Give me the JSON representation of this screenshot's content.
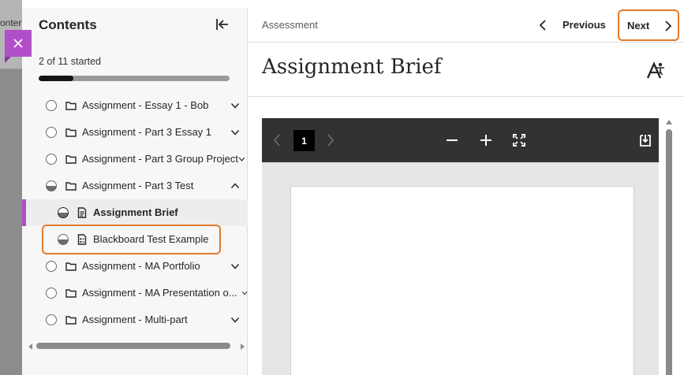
{
  "background": {
    "partial_text": "onter"
  },
  "panel": {
    "title": "Contents",
    "progress_text": "2 of 11 started",
    "progress_fraction": 0.18,
    "items": [
      {
        "label": "Assignment - Essay 1 - Bob",
        "status": "not-started",
        "expandable": "collapsed"
      },
      {
        "label": "Assignment - Part 3 Essay 1",
        "status": "not-started",
        "expandable": "collapsed"
      },
      {
        "label": "Assignment - Part 3 Group Project",
        "status": "not-started",
        "expandable": "collapsed"
      },
      {
        "label": "Assignment - Part 3 Test",
        "status": "started",
        "expandable": "expanded"
      },
      {
        "label": "Assignment Brief",
        "status": "started",
        "child": true,
        "active": true
      },
      {
        "label": "Blackboard Test Example",
        "status": "started",
        "child": true
      },
      {
        "label": "Assignment - MA Portfolio",
        "status": "not-started",
        "expandable": "collapsed"
      },
      {
        "label": "Assignment - MA Presentation o...",
        "status": "not-started",
        "expandable": "collapsed"
      },
      {
        "label": "Assignment - Multi-part",
        "status": "not-started",
        "expandable": "collapsed"
      }
    ]
  },
  "topbar": {
    "breadcrumb": "Assessment",
    "previous_label": "Previous",
    "next_label": "Next"
  },
  "main": {
    "title": "Assignment Brief"
  },
  "viewer": {
    "current_page": "1"
  },
  "colors": {
    "accent_purple": "#b04fc8",
    "highlight_orange": "#e57a2e",
    "viewer_toolbar": "#323232"
  }
}
